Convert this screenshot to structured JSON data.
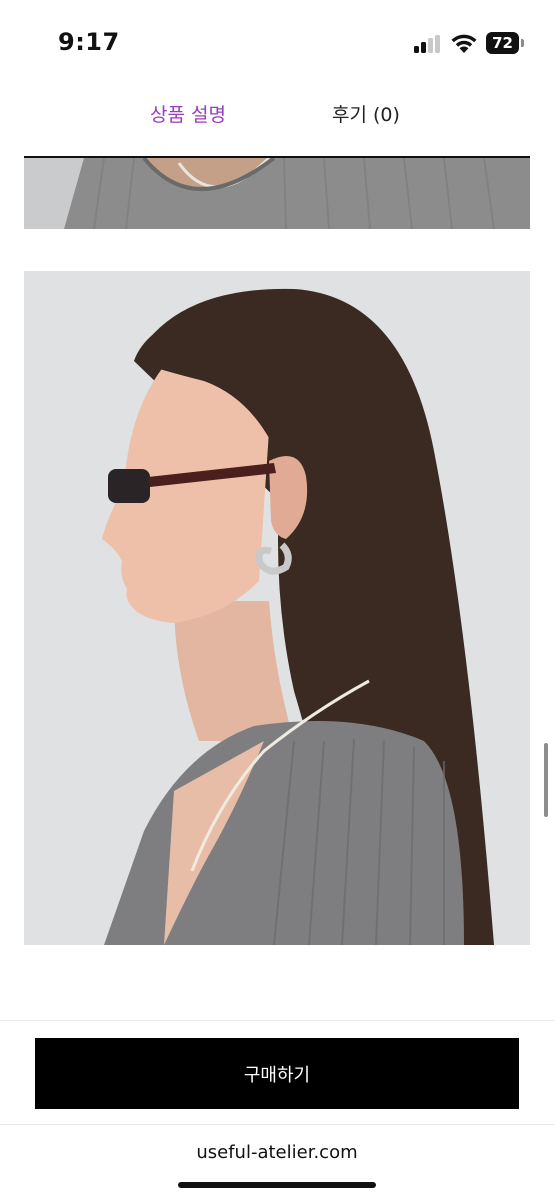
{
  "status_bar": {
    "time": "9:17",
    "battery": "72",
    "signal_bars_active": 2,
    "signal_bars_total": 4
  },
  "tabs": [
    {
      "label": "상품 설명",
      "active": true
    },
    {
      "label": "후기 (0)",
      "active": false
    }
  ],
  "colors": {
    "active_tab": "#9b3bbf",
    "button": "#000000"
  },
  "actions": {
    "buy_label": "구매하기"
  },
  "browser": {
    "url": "useful-atelier.com"
  }
}
